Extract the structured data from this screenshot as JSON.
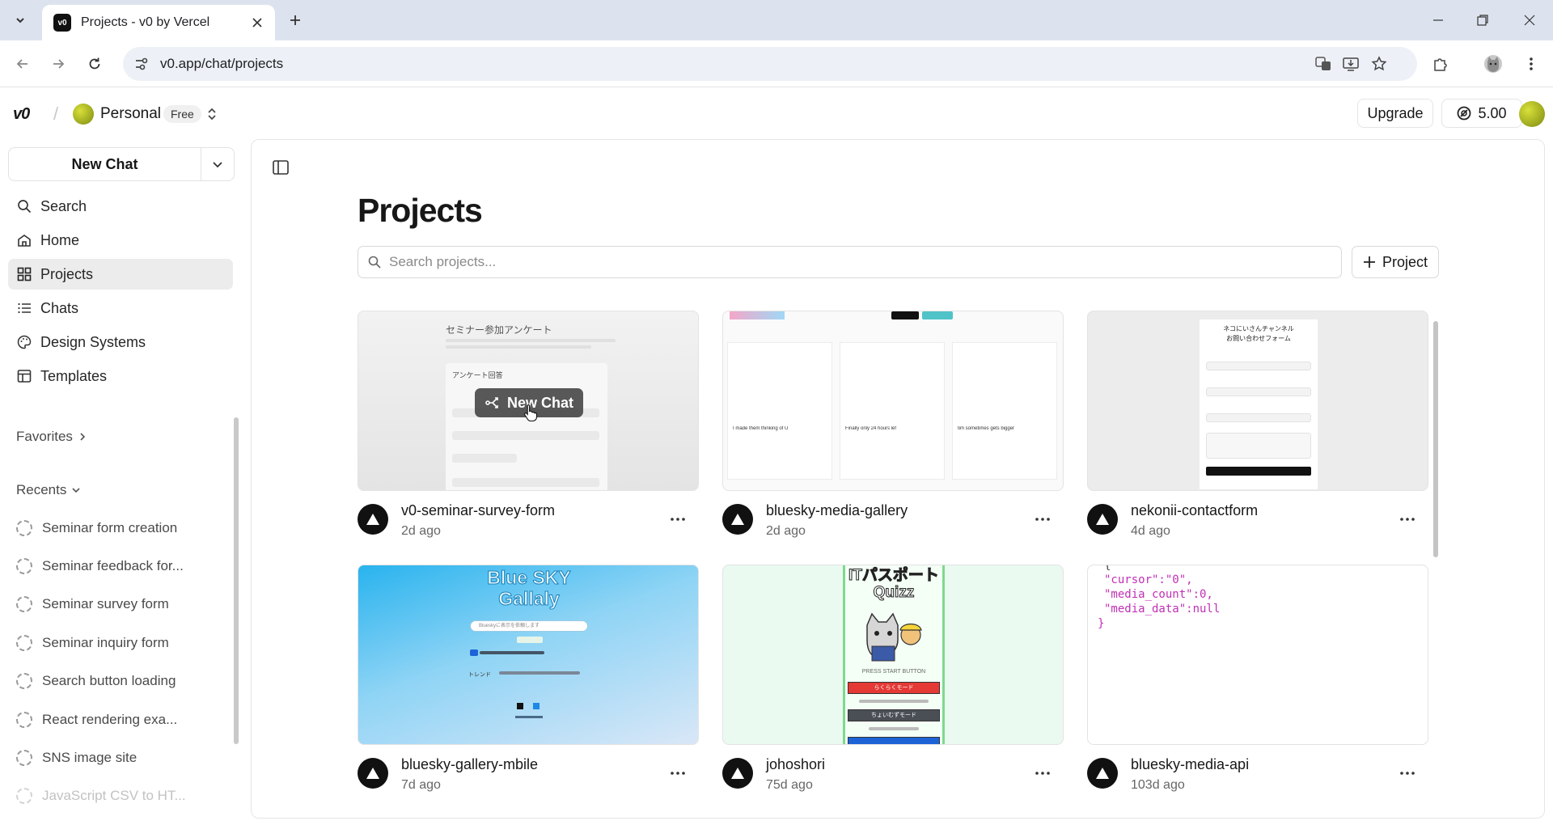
{
  "browser": {
    "tab_title": "Projects - v0 by Vercel",
    "url": "v0.app/chat/projects"
  },
  "header": {
    "logo": "v0",
    "workspace_name": "Personal",
    "plan_badge": "Free",
    "upgrade_label": "Upgrade",
    "credits": "5.00"
  },
  "sidebar": {
    "new_chat_label": "New Chat",
    "nav": [
      {
        "label": "Search",
        "icon": "search-icon"
      },
      {
        "label": "Home",
        "icon": "home-icon"
      },
      {
        "label": "Projects",
        "icon": "projects-grid-icon",
        "active": true
      },
      {
        "label": "Chats",
        "icon": "chats-list-icon"
      },
      {
        "label": "Design Systems",
        "icon": "palette-icon"
      },
      {
        "label": "Templates",
        "icon": "templates-icon"
      }
    ],
    "favorites_label": "Favorites",
    "recents_label": "Recents",
    "recents": [
      "Seminar form creation",
      "Seminar feedback for...",
      "Seminar survey form",
      "Seminar inquiry form",
      "Search button loading",
      "React rendering exa...",
      "SNS image site",
      "JavaScript CSV to HT..."
    ]
  },
  "main": {
    "title": "Projects",
    "search_placeholder": "Search projects...",
    "project_button_label": "Project",
    "hover_chip_label": "New Chat",
    "projects": [
      {
        "name": "v0-seminar-survey-form",
        "time": "2d ago"
      },
      {
        "name": "bluesky-media-gallery",
        "time": "2d ago"
      },
      {
        "name": "nekonii-contactform",
        "time": "4d ago"
      },
      {
        "name": "bluesky-gallery-mbile",
        "time": "7d ago"
      },
      {
        "name": "johoshori",
        "time": "75d ago"
      },
      {
        "name": "bluesky-media-api",
        "time": "103d ago"
      }
    ],
    "thumbnails": {
      "survey": {
        "heading": "セミナー参加アンケート",
        "section": "アンケート回答"
      },
      "gallery": {
        "caption_1": "I made them thinking of U",
        "caption_2": "Finally only 24 hours lef",
        "caption_3": "tim sometimes gets bigger"
      },
      "contact": {
        "heading_1": "ネコにいさんチャンネル",
        "heading_2": "お問い合わせフォーム"
      },
      "bluesky_mobile": {
        "title_1": "Blue SKY",
        "title_2": "Gallaly",
        "search_hint": "Blueskyに表示を依頼します",
        "trend_label": "トレンド"
      },
      "quiz": {
        "title_1": "ITパスポート",
        "title_2": "Quizz",
        "press_start": "PRESS START BUTTON",
        "mode_easy": "らくらくモード",
        "mode_hard": "ちょいむずモード"
      },
      "api": {
        "line_1": "\"cursor\":\"0\",",
        "line_2": "\"media_count\":0,",
        "line_3": "\"media_data\":null",
        "line_4": "}"
      }
    }
  },
  "colors": {
    "accent_dark": "#171717",
    "active_nav_bg": "#ececec",
    "quiz_red": "#e53935",
    "quiz_blue": "#1e63d6",
    "json_key": "#c02fb6"
  }
}
